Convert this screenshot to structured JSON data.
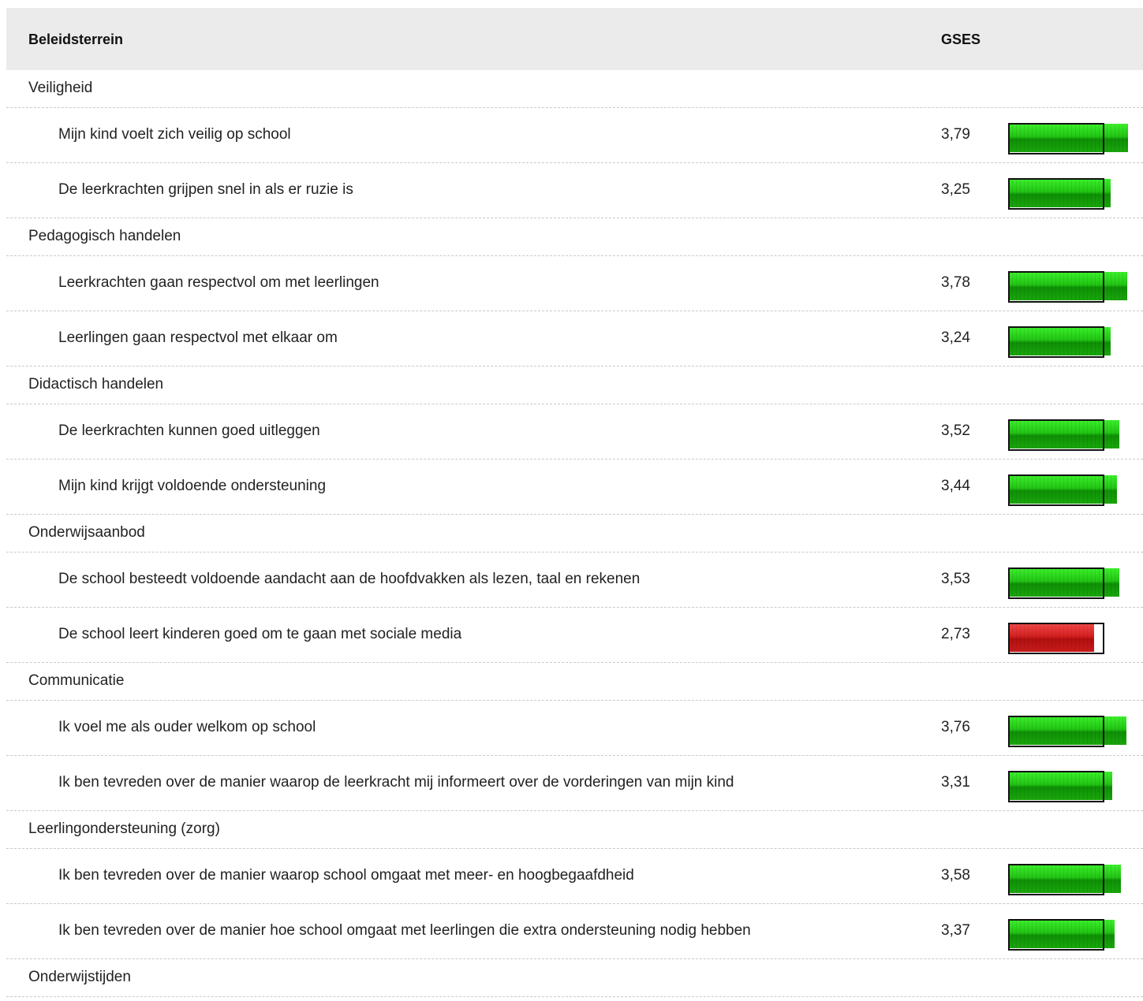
{
  "header": {
    "col_category": "Beleidsterrein",
    "col_score": "GSES"
  },
  "scale_max": 4,
  "frame_value": 3,
  "colors": {
    "good": "#22c414",
    "bad": "#d42020",
    "header_bg": "#ebebeb"
  },
  "rows": [
    {
      "type": "category",
      "label": "Veiligheid"
    },
    {
      "type": "item",
      "label": "Mijn kind voelt zich veilig op school",
      "score": "3,79",
      "value": 3.79,
      "status": "good"
    },
    {
      "type": "item",
      "label": "De leerkrachten grijpen snel in als er ruzie is",
      "score": "3,25",
      "value": 3.25,
      "status": "good"
    },
    {
      "type": "category",
      "label": "Pedagogisch handelen"
    },
    {
      "type": "item",
      "label": "Leerkrachten gaan respectvol om met leerlingen",
      "score": "3,78",
      "value": 3.78,
      "status": "good"
    },
    {
      "type": "item",
      "label": "Leerlingen gaan respectvol met elkaar om",
      "score": "3,24",
      "value": 3.24,
      "status": "good"
    },
    {
      "type": "category",
      "label": "Didactisch handelen"
    },
    {
      "type": "item",
      "label": "De leerkrachten kunnen goed uitleggen",
      "score": "3,52",
      "value": 3.52,
      "status": "good"
    },
    {
      "type": "item",
      "label": "Mijn kind krijgt voldoende ondersteuning",
      "score": "3,44",
      "value": 3.44,
      "status": "good"
    },
    {
      "type": "category",
      "label": "Onderwijsaanbod"
    },
    {
      "type": "item",
      "label": "De school besteedt voldoende aandacht aan de hoofdvakken als lezen, taal en rekenen",
      "score": "3,53",
      "value": 3.53,
      "status": "good"
    },
    {
      "type": "item",
      "label": "De school leert kinderen goed om te gaan met sociale media",
      "score": "2,73",
      "value": 2.73,
      "status": "bad"
    },
    {
      "type": "category",
      "label": "Communicatie"
    },
    {
      "type": "item",
      "label": "Ik voel me als ouder welkom op school",
      "score": "3,76",
      "value": 3.76,
      "status": "good"
    },
    {
      "type": "item",
      "label": "Ik ben tevreden over de manier waarop de leerkracht mij informeert over de vorderingen van mijn kind",
      "score": "3,31",
      "value": 3.31,
      "status": "good"
    },
    {
      "type": "category",
      "label": "Leerlingondersteuning (zorg)"
    },
    {
      "type": "item",
      "label": "Ik ben tevreden over de manier waarop school omgaat met meer- en hoogbegaafdheid",
      "score": "3,58",
      "value": 3.58,
      "status": "good"
    },
    {
      "type": "item",
      "label": "Ik ben tevreden over de manier hoe school omgaat met leerlingen die extra ondersteuning nodig hebben",
      "score": "3,37",
      "value": 3.37,
      "status": "good"
    },
    {
      "type": "category",
      "label": "Onderwijstijden"
    }
  ]
}
